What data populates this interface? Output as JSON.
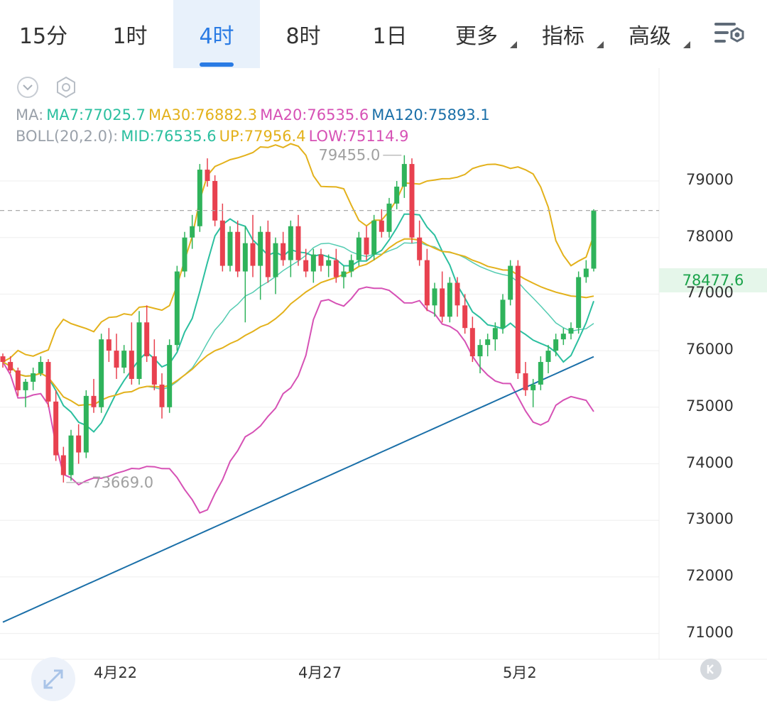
{
  "tabs": [
    {
      "label": "15分"
    },
    {
      "label": "1时"
    },
    {
      "label": "4时",
      "active": true
    },
    {
      "label": "8时"
    },
    {
      "label": "1日"
    },
    {
      "label": "更多",
      "dropdown": true
    },
    {
      "label": "指标",
      "dropdown": true
    },
    {
      "label": "高级",
      "dropdown": true
    }
  ],
  "icons": {
    "settings": "chart-settings-icon",
    "collapse": "chevron-down-icon",
    "hexagon": "hexagon-settings-icon",
    "expand": "expand-arrows-icon",
    "k": "k-icon"
  },
  "legend": {
    "ma_prefix": "MA:",
    "ma7": "MA7:77025.7",
    "ma30": "MA30:76882.3",
    "ma20": "MA20:76535.6",
    "ma120": "MA120:75893.1",
    "boll_prefix": "BOLL(20,2.0):",
    "mid": "MID:76535.6",
    "up": "UP:77956.4",
    "low": "LOW:75114.9"
  },
  "colors": {
    "ma7": "#2bbf9f",
    "ma30": "#e3b11b",
    "ma20": "#d651b5",
    "ma120": "#1a6fa8",
    "up_candle": "#2fb35b",
    "down_candle": "#e8414f",
    "grid": "#eeeeee",
    "accent": "#2a7be4"
  },
  "chart_data": {
    "type": "candlestick",
    "y_ticks": [
      79000,
      78000,
      77000,
      76000,
      75000,
      74000,
      73000,
      72000,
      71000
    ],
    "x_labels": [
      "4月22",
      "4月27",
      "5月2"
    ],
    "current_price": "78477.6",
    "max_label": "79455.0",
    "min_label": "73669.0",
    "candles": [
      [
        75900,
        75950,
        75700,
        75800
      ],
      [
        75800,
        75900,
        75600,
        75650
      ],
      [
        75650,
        75700,
        75200,
        75300
      ],
      [
        75300,
        75500,
        75000,
        75450
      ],
      [
        75450,
        75700,
        75300,
        75600
      ],
      [
        75600,
        75900,
        75550,
        75800
      ],
      [
        75800,
        75850,
        75000,
        75100
      ],
      [
        75100,
        75300,
        74050,
        74150
      ],
      [
        74150,
        74300,
        73669,
        73800
      ],
      [
        73800,
        74600,
        73700,
        74500
      ],
      [
        74500,
        74700,
        74000,
        74200
      ],
      [
        74200,
        75300,
        74100,
        75200
      ],
      [
        75200,
        75500,
        74900,
        75000
      ],
      [
        75000,
        76300,
        74900,
        76200
      ],
      [
        76200,
        76400,
        75800,
        76000
      ],
      [
        76000,
        76300,
        75500,
        75700
      ],
      [
        75700,
        76100,
        75600,
        76000
      ],
      [
        76000,
        76500,
        75400,
        75500
      ],
      [
        75500,
        76700,
        75400,
        76500
      ],
      [
        76500,
        76800,
        75800,
        75900
      ],
      [
        75900,
        76200,
        75300,
        75400
      ],
      [
        75400,
        75600,
        74800,
        75000
      ],
      [
        75000,
        76200,
        74900,
        76100
      ],
      [
        76100,
        77500,
        76000,
        77400
      ],
      [
        77400,
        78100,
        77300,
        78000
      ],
      [
        78000,
        78400,
        77800,
        78200
      ],
      [
        78200,
        79300,
        78100,
        79200
      ],
      [
        79200,
        79400,
        78900,
        79000
      ],
      [
        79000,
        79100,
        78200,
        78300
      ],
      [
        78300,
        78600,
        77400,
        77500
      ],
      [
        77500,
        78200,
        77400,
        78100
      ],
      [
        78100,
        78300,
        77300,
        77400
      ],
      [
        77400,
        78200,
        76500,
        77900
      ],
      [
        77900,
        78400,
        77300,
        77500
      ],
      [
        77500,
        78200,
        76900,
        78100
      ],
      [
        78100,
        78300,
        77200,
        77300
      ],
      [
        77300,
        78000,
        77000,
        77900
      ],
      [
        77900,
        78100,
        77500,
        77600
      ],
      [
        77600,
        78300,
        77300,
        78200
      ],
      [
        78200,
        78400,
        77500,
        77600
      ],
      [
        77600,
        77800,
        77300,
        77400
      ],
      [
        77400,
        77800,
        77200,
        77700
      ],
      [
        77700,
        77800,
        77400,
        77500
      ],
      [
        77500,
        77700,
        77300,
        77600
      ],
      [
        77600,
        77800,
        77200,
        77300
      ],
      [
        77300,
        77500,
        77100,
        77400
      ],
      [
        77400,
        77700,
        77300,
        77600
      ],
      [
        77600,
        78100,
        77500,
        78000
      ],
      [
        78000,
        78200,
        77600,
        77700
      ],
      [
        77700,
        78400,
        77600,
        78300
      ],
      [
        78300,
        78500,
        78000,
        78100
      ],
      [
        78100,
        78700,
        78000,
        78600
      ],
      [
        78600,
        79000,
        78500,
        78900
      ],
      [
        78900,
        79455,
        78700,
        79300
      ],
      [
        79300,
        79400,
        77900,
        78000
      ],
      [
        78000,
        78300,
        77500,
        77600
      ],
      [
        77600,
        77800,
        76700,
        76800
      ],
      [
        76800,
        77200,
        76600,
        77100
      ],
      [
        77100,
        77400,
        76500,
        76600
      ],
      [
        76600,
        77300,
        76500,
        77200
      ],
      [
        77200,
        77300,
        76600,
        76800
      ],
      [
        76800,
        77000,
        76300,
        76400
      ],
      [
        76400,
        76600,
        75800,
        75900
      ],
      [
        75900,
        76200,
        75600,
        76100
      ],
      [
        76100,
        76300,
        75900,
        76200
      ],
      [
        76200,
        76500,
        76000,
        76400
      ],
      [
        76400,
        77000,
        76300,
        76900
      ],
      [
        76900,
        77600,
        76800,
        77500
      ],
      [
        77500,
        77600,
        75500,
        75600
      ],
      [
        75600,
        75800,
        75200,
        75300
      ],
      [
        75300,
        75500,
        75000,
        75400
      ],
      [
        75400,
        75900,
        75300,
        75800
      ],
      [
        75800,
        76100,
        75600,
        76000
      ],
      [
        76000,
        76300,
        75900,
        76200
      ],
      [
        76200,
        76400,
        76100,
        76300
      ],
      [
        76300,
        76500,
        76200,
        76400
      ],
      [
        76400,
        77400,
        76300,
        77300
      ],
      [
        77300,
        77600,
        77200,
        77450
      ],
      [
        77450,
        78500,
        77400,
        78478
      ]
    ]
  }
}
